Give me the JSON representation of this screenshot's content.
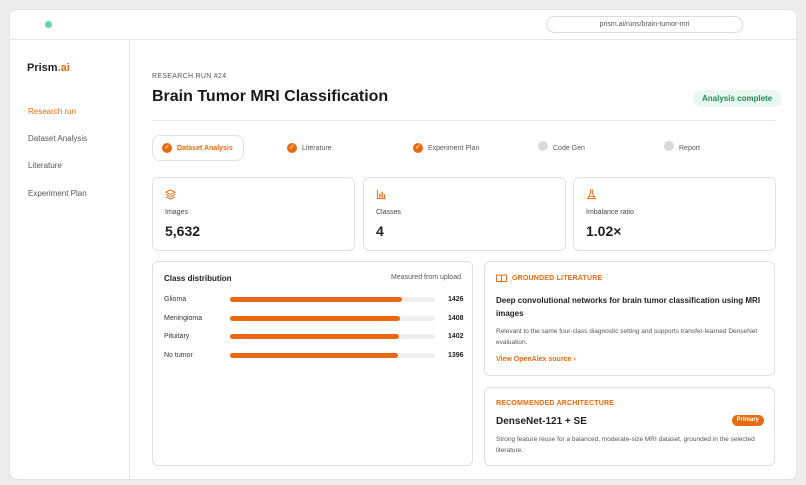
{
  "browser": {
    "url": "prism.ai/runs/brain-tumor-mri",
    "dot_color": "#66d3a8"
  },
  "brand": {
    "name": "Prism",
    "suffix": ".ai"
  },
  "sidebar": {
    "items": [
      {
        "label": "Research run",
        "active": true
      },
      {
        "label": "Dataset Analysis",
        "active": false
      },
      {
        "label": "Literature",
        "active": false
      },
      {
        "label": "Experiment Plan",
        "active": false
      }
    ]
  },
  "header": {
    "eyebrow": "RESEARCH RUN #24",
    "title": "Brain Tumor MRI Classification",
    "status": "Analysis complete"
  },
  "steps": [
    {
      "label": "Dataset Analysis",
      "state": "active"
    },
    {
      "label": "Literature",
      "state": "done"
    },
    {
      "label": "Experiment Plan",
      "state": "done"
    },
    {
      "label": "Code Gen",
      "state": "pending"
    },
    {
      "label": "Report",
      "state": "pending"
    }
  ],
  "stats": [
    {
      "label": "Images",
      "value": "5,632",
      "icon": "layers-icon"
    },
    {
      "label": "Classes",
      "value": "4",
      "icon": "bar-chart-icon"
    },
    {
      "label": "Imbalance ratio",
      "value": "1.02×",
      "icon": "flask-icon"
    }
  ],
  "distribution": {
    "title": "Class distribution",
    "note": "Measured from upload",
    "max": 1700,
    "rows": [
      {
        "name": "Glioma",
        "value": 1426,
        "display": "1426"
      },
      {
        "name": "Meningioma",
        "value": 1408,
        "display": "1408"
      },
      {
        "name": "Pituitary",
        "value": 1402,
        "display": "1402"
      },
      {
        "name": "No tumor",
        "value": 1396,
        "display": "1396"
      }
    ]
  },
  "literature": {
    "kicker": "GROUNDED LITERATURE",
    "title": "Deep convolutional networks for brain tumor classification using MRI images",
    "body": "Relevant to the same four-class diagnostic setting and supports transfer-learned DenseNet evaluation.",
    "link": "View OpenAlex source ›"
  },
  "architecture": {
    "kicker": "RECOMMENDED ARCHITECTURE",
    "title": "DenseNet-121 + SE",
    "badge": "Primary",
    "body": "Strong feature reuse for a balanced, moderate-size MRI dataset, grounded in the selected literature."
  },
  "colors": {
    "accent": "#e8690f",
    "success_bg": "#e8f7ef",
    "success_text": "#1f8a5a"
  }
}
